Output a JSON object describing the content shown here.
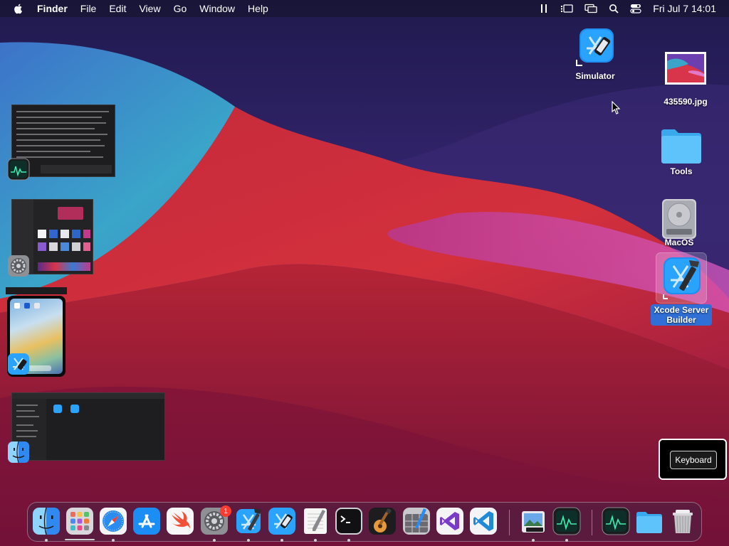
{
  "menubar": {
    "app_name": "Finder",
    "menus": [
      "File",
      "Edit",
      "View",
      "Go",
      "Window",
      "Help"
    ],
    "clock": "Fri Jul 7  14:01"
  },
  "desktop": {
    "simulator": "Simulator",
    "jpg": "435590.jpg",
    "tools": "Tools",
    "macos": "MacOS",
    "xcode_server": "Xcode Server Builder"
  },
  "keyboard": {
    "label": "Keyboard"
  },
  "dock": {
    "settings_badge": "1"
  },
  "colors": {
    "accent": "#2f6fd6",
    "badge": "#ff3b30"
  }
}
